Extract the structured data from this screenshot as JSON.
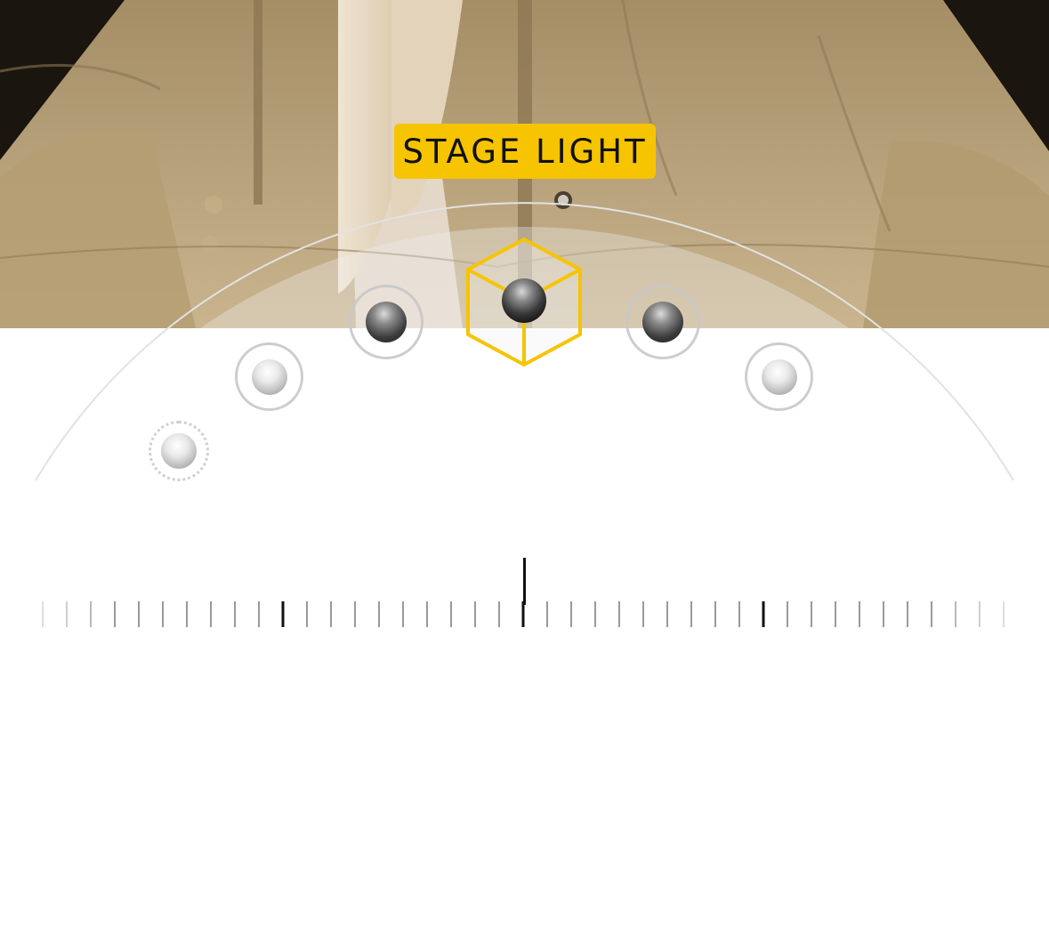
{
  "mode_label": "STAGE LIGHT",
  "selected_mode_icon": "cube-icon",
  "accent_color": "#f6c400",
  "lighting_modes": [
    {
      "name": "natural-light",
      "icon": "dotted-sphere-icon"
    },
    {
      "name": "studio-light",
      "icon": "sphere-icon"
    },
    {
      "name": "contour-light",
      "icon": "sphere-icon"
    },
    {
      "name": "stage-light",
      "icon": "cube-icon"
    },
    {
      "name": "stage-light-mono",
      "icon": "sphere-icon"
    },
    {
      "name": "high-key-light-mono",
      "icon": "sphere-icon"
    }
  ],
  "intensity_slider": {
    "value": 0.5
  }
}
